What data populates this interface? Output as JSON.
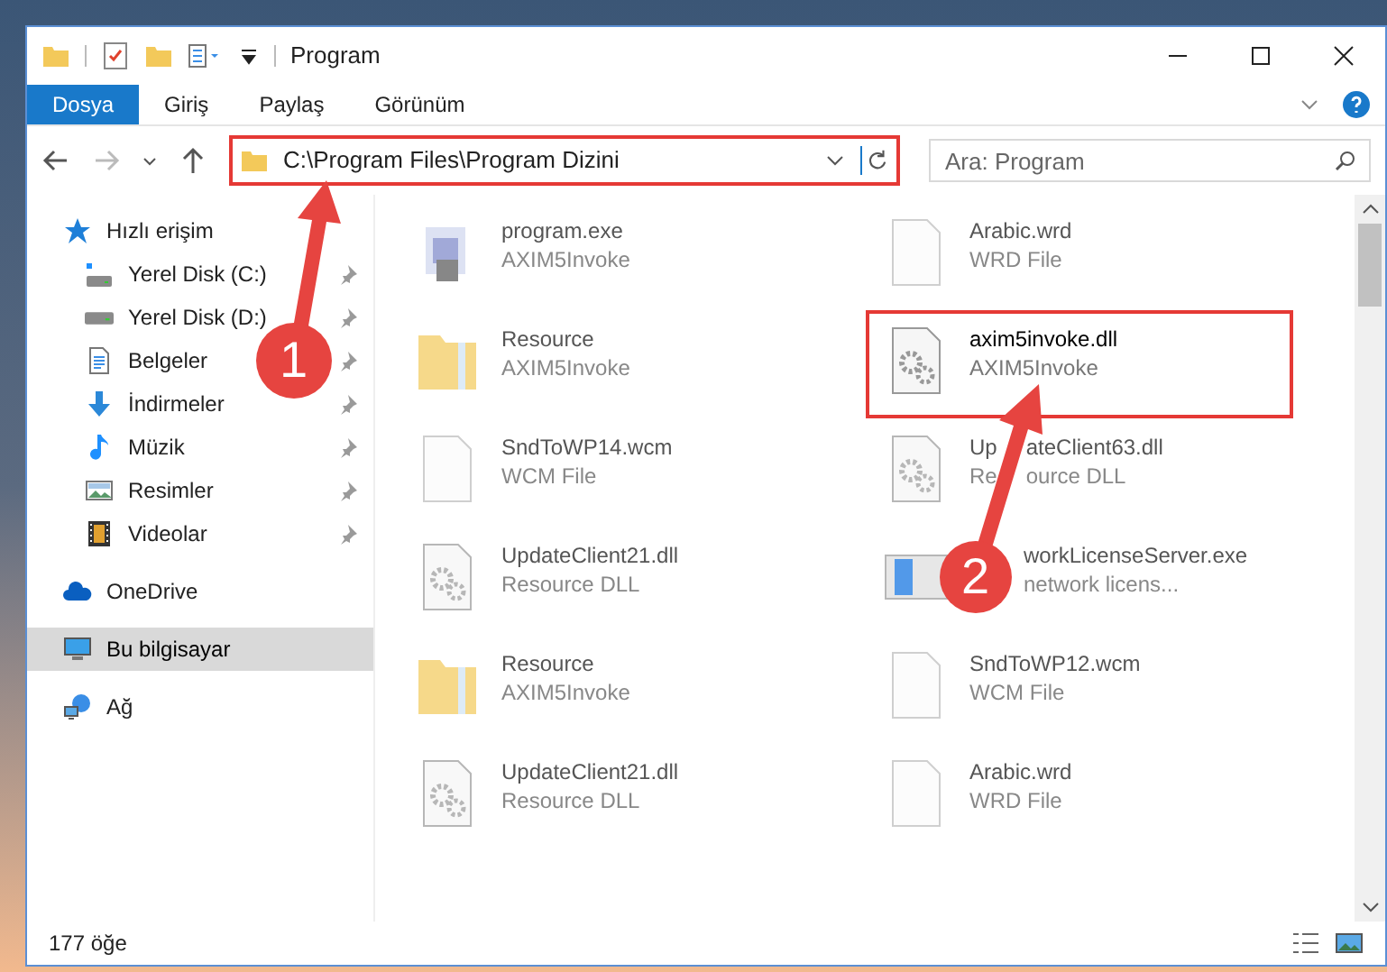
{
  "window": {
    "title": "Program"
  },
  "ribbon_tabs": [
    {
      "label": "Dosya",
      "selected": true
    },
    {
      "label": "Giriş",
      "selected": false
    },
    {
      "label": "Paylaş",
      "selected": false
    },
    {
      "label": "Görünüm",
      "selected": false
    }
  ],
  "address": {
    "path": "C:\\Program Files\\Program Dizini"
  },
  "search": {
    "placeholder": "Ara: Program"
  },
  "nav": [
    {
      "label": "Hızlı erişim",
      "kind": "star",
      "selected": false,
      "children": [
        {
          "label": "Yerel Disk (C:)",
          "kind": "drive-c",
          "selected": false,
          "pinned": true
        },
        {
          "label": "Yerel Disk (D:)",
          "kind": "drive",
          "selected": false,
          "pinned": true
        },
        {
          "label": "Belgeler",
          "kind": "docs",
          "selected": false,
          "pinned": true
        },
        {
          "label": "İndirmeler",
          "kind": "download",
          "selected": false,
          "pinned": true
        },
        {
          "label": "Müzik",
          "kind": "music",
          "selected": false,
          "pinned": true
        },
        {
          "label": "Resimler",
          "kind": "pictures",
          "selected": false,
          "pinned": true
        },
        {
          "label": "Videolar",
          "kind": "video",
          "selected": false,
          "pinned": true
        }
      ]
    },
    {
      "label": "OneDrive",
      "kind": "cloud",
      "selected": false
    },
    {
      "label": "Bu bilgisayar",
      "kind": "pc",
      "selected": true
    },
    {
      "label": "Ağ",
      "kind": "network",
      "selected": false
    }
  ],
  "files": [
    {
      "name": [
        "program.exe"
      ],
      "type": [
        "AXIM5Invoke"
      ],
      "kind": "exe",
      "highlighted": false
    },
    {
      "name": [
        "Arabic.wrd"
      ],
      "type": [
        "WRD File"
      ],
      "kind": "file",
      "highlighted": false
    },
    {
      "name": [
        "Resource"
      ],
      "type": [
        "AXIM5Invoke"
      ],
      "kind": "folder",
      "highlighted": false
    },
    {
      "name": [
        "axim5invoke.dll"
      ],
      "type": [
        "AXIM5Invoke"
      ],
      "kind": "dll",
      "highlighted": true
    },
    {
      "name": [
        "SndToWP14.wcm"
      ],
      "type": [
        "WCM File"
      ],
      "kind": "file",
      "highlighted": false
    },
    {
      "name": [
        "Up",
        "ateClient63.dll"
      ],
      "type": [
        "Re",
        "ource DLL"
      ],
      "kind": "dll",
      "highlighted": false
    },
    {
      "name": [
        "UpdateClient21.dll"
      ],
      "type": [
        "Resource DLL"
      ],
      "kind": "dll",
      "highlighted": false
    },
    {
      "name": [
        "workLicenseServer.exe"
      ],
      "type": [
        "network licens..."
      ],
      "kind": "app",
      "highlighted": false,
      "covered_start": true
    },
    {
      "name": [
        "Resource"
      ],
      "type": [
        "AXIM5Invoke"
      ],
      "kind": "folder",
      "highlighted": false
    },
    {
      "name": [
        "SndToWP12.wcm"
      ],
      "type": [
        "WCM File"
      ],
      "kind": "file",
      "highlighted": false
    },
    {
      "name": [
        "UpdateClient21.dll"
      ],
      "type": [
        "Resource DLL"
      ],
      "kind": "dll",
      "highlighted": false
    },
    {
      "name": [
        "Arabic.wrd"
      ],
      "type": [
        "WRD File"
      ],
      "kind": "file",
      "highlighted": false
    }
  ],
  "status_bar": {
    "count": "177 öğe"
  },
  "annotations": [
    {
      "number": "1"
    },
    {
      "number": "2"
    }
  ]
}
